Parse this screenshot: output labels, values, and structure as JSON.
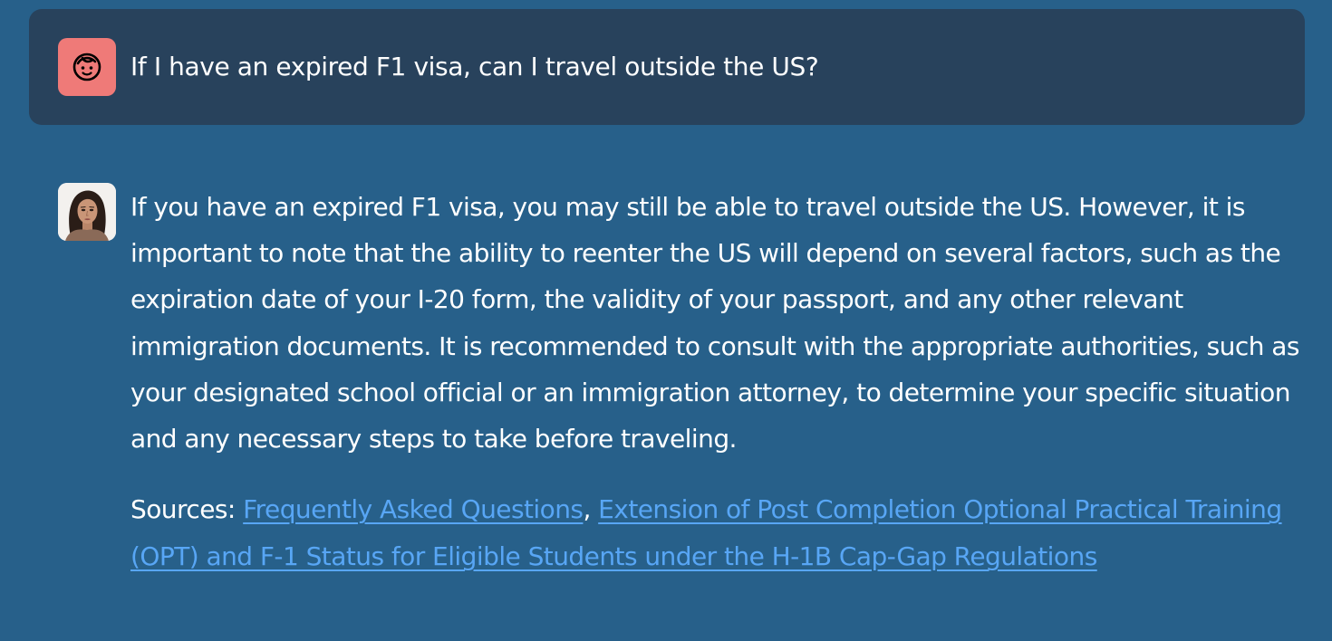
{
  "user": {
    "avatar_icon": "face-icon",
    "avatar_color": "#ef7a78",
    "question": "If I have an expired F1 visa, can I travel outside the US?"
  },
  "assistant": {
    "avatar_icon": "woman-portrait-avatar",
    "answer": "If you have an expired F1 visa, you may still be able to travel outside the US. However, it is important to note that the ability to reenter the US will depend on several factors, such as the expiration date of your I-20 form, the validity of your passport, and any other relevant immigration documents. It is recommended to consult with the appropriate authorities, such as your designated school official or an immigration attorney, to determine your specific situation and any necessary steps to take before traveling.",
    "sources_label": "Sources:",
    "sources": [
      "Frequently Asked Questions",
      "Extension of Post Completion Optional Practical Training (OPT) and F-1 Status for Eligible Students under the H-1B Cap-Gap Regulations"
    ],
    "separator": ", "
  },
  "colors": {
    "background": "#27608a",
    "user_bubble": "#28425c",
    "link": "#58a6f5",
    "text": "#ffffff"
  }
}
